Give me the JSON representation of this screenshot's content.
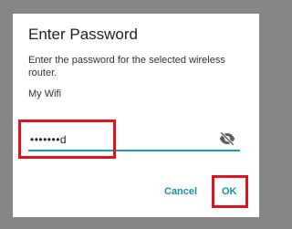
{
  "dialog": {
    "title": "Enter Password",
    "message": "Enter the password for the selected wireless router.",
    "network_name": "My Wifi",
    "password_field": {
      "value": "•••••••d",
      "toggle_icon": "eye-off-icon"
    },
    "buttons": {
      "cancel": "Cancel",
      "ok": "OK"
    }
  },
  "colors": {
    "accent": "#1a8fa3",
    "field_underline": "#1a9cb0",
    "annotation_highlight": "#e0141e",
    "backdrop": "#868686"
  }
}
